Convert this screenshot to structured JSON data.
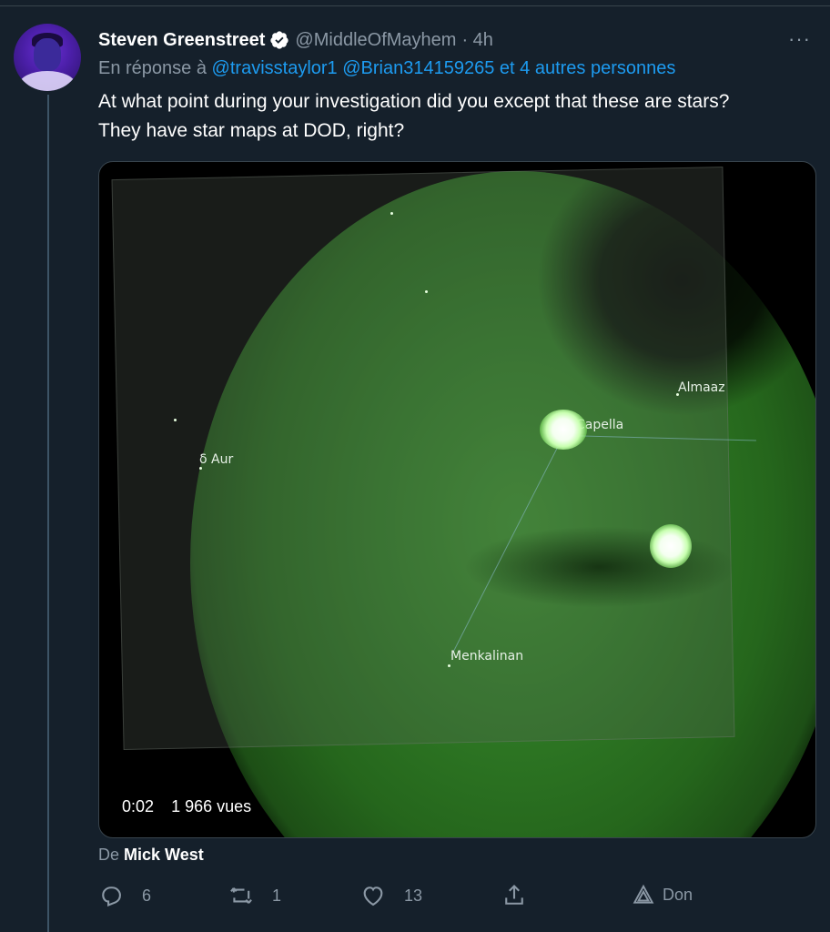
{
  "author": {
    "name": "Steven Greenstreet",
    "handle": "@MiddleOfMayhem",
    "time": "· 4h",
    "more_label": "···"
  },
  "reply": {
    "prefix": "En réponse à",
    "mention1": "@travisstaylor1",
    "mention2": "@Brian314159265",
    "others": "et 4 autres personnes"
  },
  "tweet": {
    "line1": "At what point during your investigation did you except that these are stars?",
    "line2": "They have star maps at DOD, right?"
  },
  "media": {
    "labels": {
      "almaaz": "Almaaz",
      "capella": "Capella",
      "delta_aur": "δ Aur",
      "menkalinan": "Menkalinan"
    },
    "timestamp": "0:02",
    "views": "1 966 vues"
  },
  "source": {
    "prefix": "De",
    "name": "Mick West"
  },
  "actions": {
    "reply_count": "6",
    "retweet_count": "1",
    "like_count": "13",
    "donate_label": "Don"
  },
  "colors": {
    "background": "#15202b",
    "accent": "#1d9bf0",
    "muted": "#8b98a5"
  }
}
